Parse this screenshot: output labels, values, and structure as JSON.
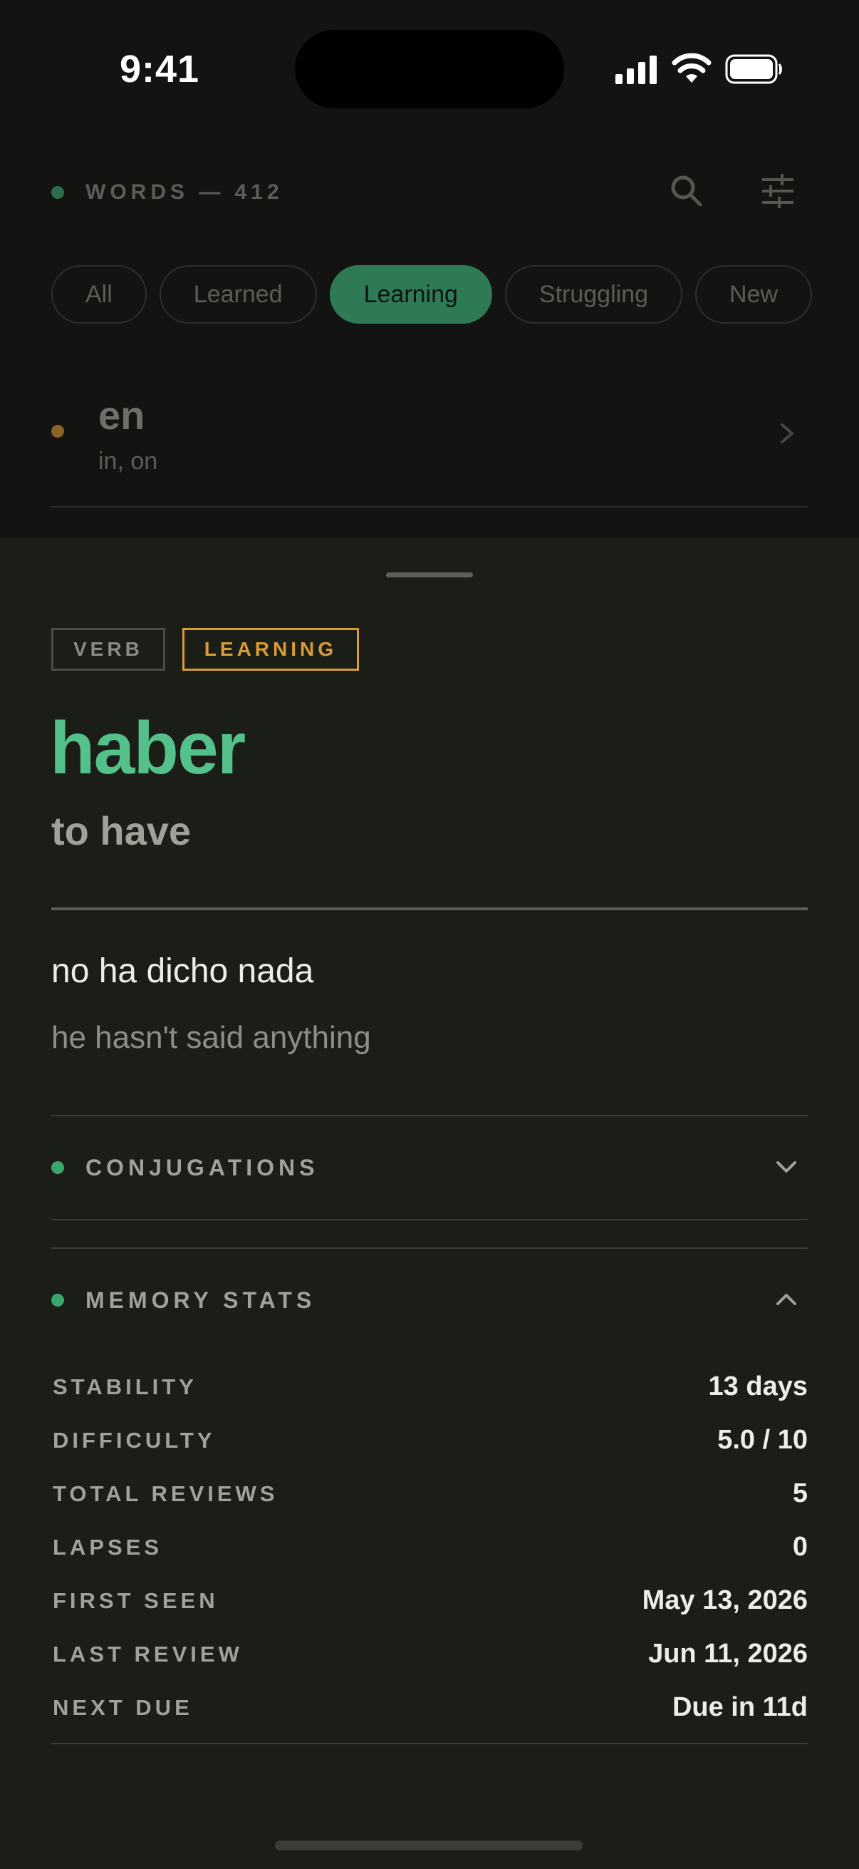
{
  "status_bar": {
    "time": "9:41"
  },
  "header": {
    "title": "WORDS — 412"
  },
  "filters": [
    "All",
    "Learned",
    "Learning",
    "Struggling",
    "New"
  ],
  "active_filter": "Learning",
  "list": [
    {
      "word": "en",
      "translation": "in, on"
    }
  ],
  "sheet": {
    "part_of_speech": "VERB",
    "status": "LEARNING",
    "word": "haber",
    "translation": "to have",
    "example": "no ha dicho nada",
    "example_translation": "he hasn't said anything",
    "conjugations_label": "CONJUGATIONS",
    "memory_stats_label": "MEMORY STATS",
    "stats": [
      {
        "label": "STABILITY",
        "value": "13 days"
      },
      {
        "label": "DIFFICULTY",
        "value": "5.0 / 10"
      },
      {
        "label": "TOTAL REVIEWS",
        "value": "5"
      },
      {
        "label": "LAPSES",
        "value": "0"
      },
      {
        "label": "FIRST SEEN",
        "value": "May 13, 2026"
      },
      {
        "label": "LAST REVIEW",
        "value": "Jun 11, 2026"
      },
      {
        "label": "NEXT DUE",
        "value": "Due in 11d"
      }
    ]
  },
  "colors": {
    "accent_green": "#54c18a",
    "learning_amber": "#d89b36",
    "sheet_bg": "#1b1d17"
  },
  "icons": [
    "signal-icon",
    "wifi-icon",
    "battery-icon",
    "search-icon",
    "sliders-icon",
    "chevron-right-icon",
    "chevron-down-icon",
    "chevron-up-icon"
  ]
}
